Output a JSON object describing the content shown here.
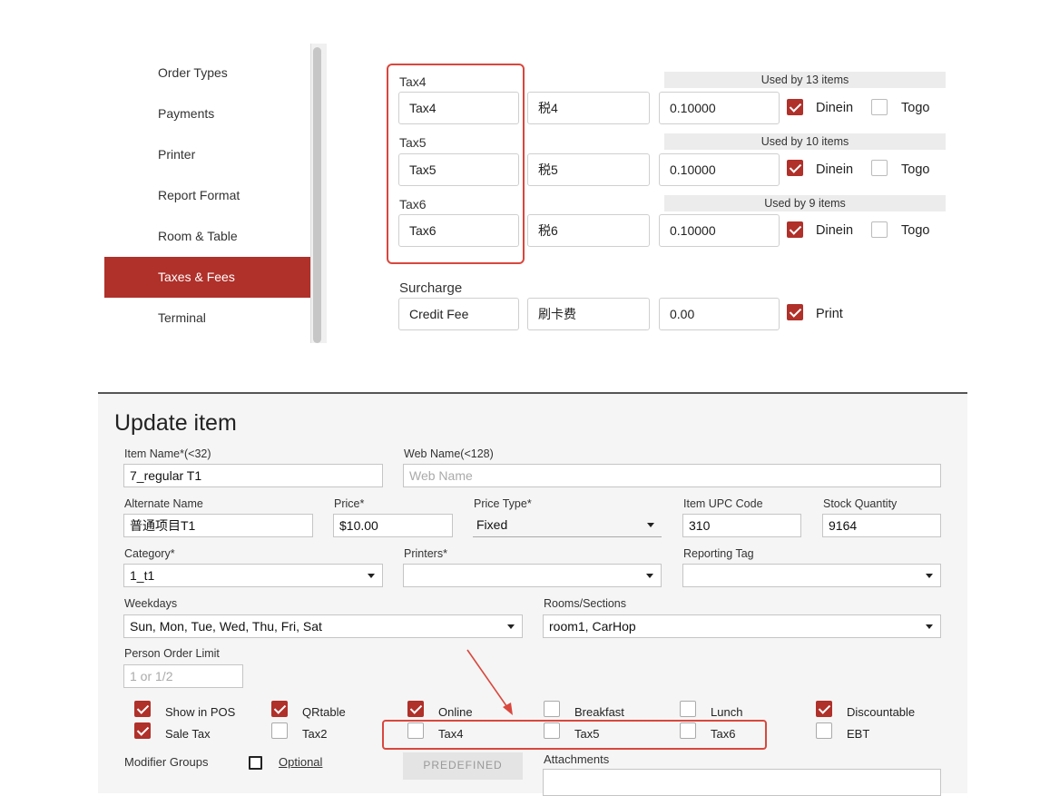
{
  "sidebar": {
    "items": [
      {
        "label": "Order Types"
      },
      {
        "label": "Payments"
      },
      {
        "label": "Printer"
      },
      {
        "label": "Report Format"
      },
      {
        "label": "Room & Table"
      },
      {
        "label": "Taxes & Fees",
        "active": true
      },
      {
        "label": "Terminal"
      }
    ]
  },
  "taxes": [
    {
      "header": "Tax4",
      "name": "Tax4",
      "alt": "税4",
      "rate": "0.10000",
      "used": "Used by 13 items",
      "dinein": true,
      "togo": false
    },
    {
      "header": "Tax5",
      "name": "Tax5",
      "alt": "税5",
      "rate": "0.10000",
      "used": "Used by 10 items",
      "dinein": true,
      "togo": false
    },
    {
      "header": "Tax6",
      "name": "Tax6",
      "alt": "税6",
      "rate": "0.10000",
      "used": "Used by 9 items",
      "dinein": true,
      "togo": false
    }
  ],
  "tax_labels": {
    "dinein": "Dinein",
    "togo": "Togo"
  },
  "surcharge": {
    "header": "Surcharge",
    "name": "Credit Fee",
    "alt": "刷卡费",
    "amount": "0.00",
    "print_label": "Print",
    "print": true
  },
  "dialog": {
    "title": "Update item",
    "item_name": {
      "label": "Item Name*(<32)",
      "value": "7_regular T1"
    },
    "web_name": {
      "label": "Web Name(<128)",
      "placeholder": "Web Name"
    },
    "alternate_name": {
      "label": "Alternate Name",
      "value": "普通项目T1"
    },
    "price": {
      "label": "Price*",
      "value": "$10.00"
    },
    "price_type": {
      "label": "Price Type*",
      "value": "Fixed"
    },
    "upc": {
      "label": "Item UPC Code",
      "value": "310"
    },
    "stock": {
      "label": "Stock Quantity",
      "value": "9164"
    },
    "category": {
      "label": "Category*",
      "value": "1_t1"
    },
    "printers": {
      "label": "Printers*",
      "value": ""
    },
    "reporting_tag": {
      "label": "Reporting Tag",
      "value": ""
    },
    "weekdays": {
      "label": "Weekdays",
      "value": "Sun, Mon, Tue, Wed, Thu, Fri, Sat"
    },
    "rooms": {
      "label": "Rooms/Sections",
      "value": "room1, CarHop"
    },
    "person_limit": {
      "label": "Person Order Limit",
      "placeholder": "1 or 1/2"
    },
    "checks": {
      "show_in_pos": {
        "label": "Show in POS",
        "checked": true
      },
      "qrtable": {
        "label": "QRtable",
        "checked": true
      },
      "online": {
        "label": "Online",
        "checked": true
      },
      "breakfast": {
        "label": "Breakfast",
        "checked": false
      },
      "lunch": {
        "label": "Lunch",
        "checked": false
      },
      "discountable": {
        "label": "Discountable",
        "checked": true
      },
      "sale_tax": {
        "label": "Sale Tax",
        "checked": true
      },
      "tax2": {
        "label": "Tax2",
        "checked": false
      },
      "tax4": {
        "label": "Tax4",
        "checked": false
      },
      "tax5": {
        "label": "Tax5",
        "checked": false
      },
      "tax6": {
        "label": "Tax6",
        "checked": false
      },
      "ebt": {
        "label": "EBT",
        "checked": false
      }
    },
    "modifier_groups": {
      "label": "Modifier Groups",
      "optional_label": "Optional"
    },
    "predefined_label": "PREDEFINED",
    "attachments_label": "Attachments"
  },
  "colors": {
    "accent": "#b0302a",
    "highlight": "#d9473d"
  }
}
